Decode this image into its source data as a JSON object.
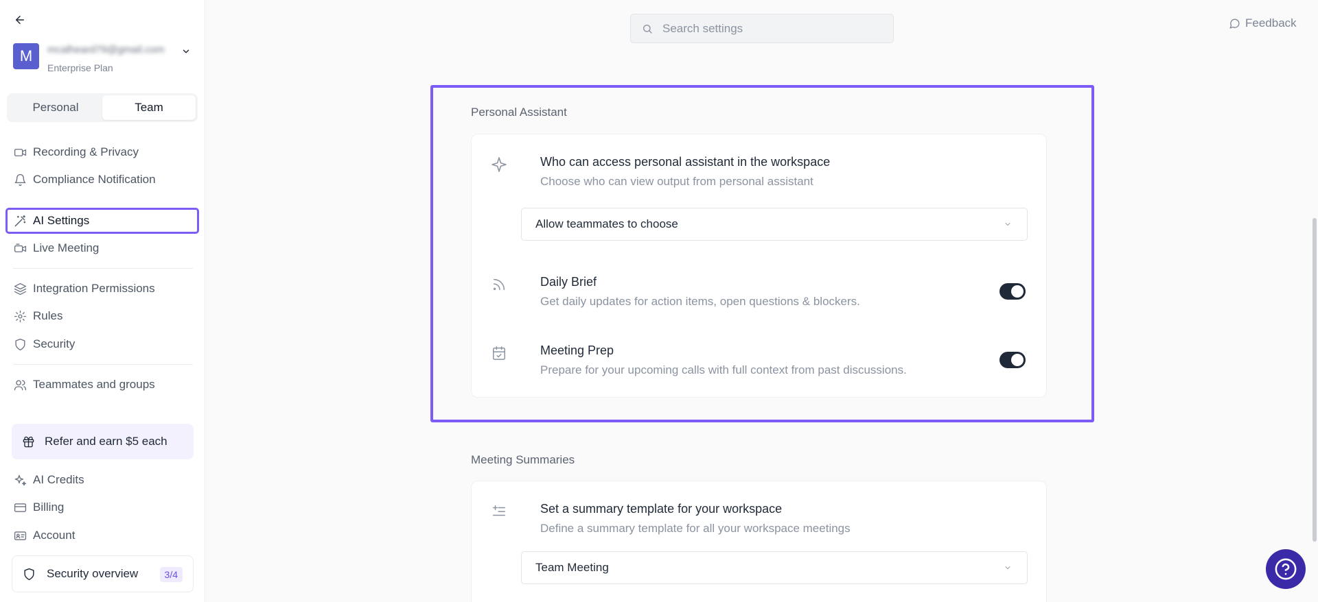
{
  "sidebar": {
    "account": {
      "avatar_letter": "M",
      "email": "mcalheard79@gmail.com",
      "plan": "Enterprise Plan"
    },
    "segment": {
      "personal": "Personal",
      "team": "Team",
      "active": "Team"
    },
    "items": [
      {
        "label": "Recording & Privacy",
        "icon": "video-icon"
      },
      {
        "label": "Compliance Notification",
        "icon": "bell-icon"
      },
      {
        "label": "AI Settings",
        "icon": "magic-wand-icon",
        "selected": true
      },
      {
        "label": "Live Meeting",
        "icon": "video-live-icon"
      },
      {
        "label": "Integration Permissions",
        "icon": "layers-icon"
      },
      {
        "label": "Rules",
        "icon": "gear-rule-icon"
      },
      {
        "label": "Security",
        "icon": "shield-icon"
      },
      {
        "label": "Teammates and groups",
        "icon": "users-icon"
      },
      {
        "label": "AI Credits",
        "icon": "sparkles-icon"
      },
      {
        "label": "Billing",
        "icon": "credit-card-icon"
      },
      {
        "label": "Account",
        "icon": "id-card-icon"
      }
    ],
    "refer": "Refer and earn $5 each",
    "security_overview": {
      "label": "Security overview",
      "badge": "3/4"
    }
  },
  "header": {
    "search_placeholder": "Search settings",
    "feedback": "Feedback"
  },
  "sections": {
    "personal_assistant": {
      "title": "Personal Assistant",
      "access": {
        "title": "Who can access personal assistant in the workspace",
        "desc": "Choose who can view output from personal assistant",
        "selected": "Allow teammates to choose"
      },
      "daily_brief": {
        "title": "Daily Brief",
        "desc": "Get daily updates for action items, open questions & blockers.",
        "enabled": true
      },
      "meeting_prep": {
        "title": "Meeting Prep",
        "desc": "Prepare for your upcoming calls with full context from past discussions.",
        "enabled": true
      }
    },
    "meeting_summaries": {
      "title": "Meeting Summaries",
      "template": {
        "title": "Set a summary template for your workspace",
        "desc": "Define a summary template for all your workspace meetings",
        "selected": "Team Meeting"
      }
    }
  },
  "colors": {
    "accent": "#7c5cf5",
    "toggle_on": "#1f2937",
    "help": "#3b2aa8",
    "avatar": "#5a5fd0"
  }
}
